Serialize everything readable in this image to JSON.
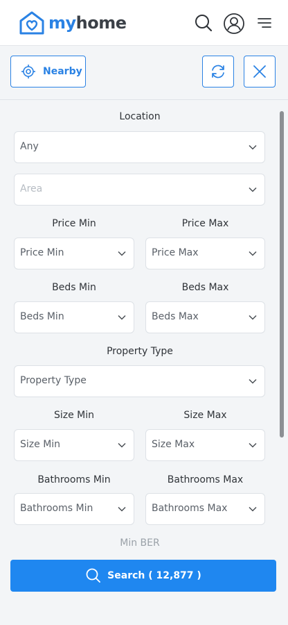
{
  "header": {
    "logo_text_brand": "my",
    "logo_text_rest": "home",
    "icons": [
      "search-icon",
      "account-icon",
      "menu-icon"
    ]
  },
  "toolbar": {
    "nearby_label": "Nearby",
    "icons": [
      "location-target-icon",
      "refresh-icon",
      "close-icon"
    ]
  },
  "form": {
    "location_label": "Location",
    "location_value": "Any",
    "area_placeholder": "Area",
    "price_min_label": "Price Min",
    "price_max_label": "Price Max",
    "price_min_value": "Price Min",
    "price_max_value": "Price Max",
    "beds_min_label": "Beds Min",
    "beds_max_label": "Beds Max",
    "beds_min_value": "Beds Min",
    "beds_max_value": "Beds Max",
    "property_type_label": "Property Type",
    "property_type_value": "Property Type",
    "size_min_label": "Size Min",
    "size_max_label": "Size Max",
    "size_min_value": "Size Min",
    "size_max_value": "Size Max",
    "bathrooms_min_label": "Bathrooms Min",
    "bathrooms_max_label": "Bathrooms Max",
    "bathrooms_min_value": "Bathrooms Min",
    "bathrooms_max_value": "Bathrooms Max",
    "min_ber_label": "Min BER"
  },
  "search": {
    "label": "Search ( 12,877 )"
  },
  "colors": {
    "accent": "#2a82e4",
    "search_button": "#1f87f0",
    "panel_bg": "#f3f5f7"
  }
}
